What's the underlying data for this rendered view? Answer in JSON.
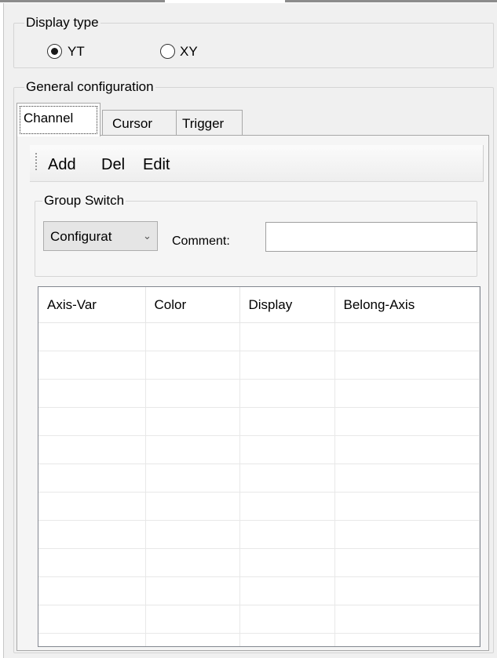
{
  "display_type": {
    "title": "Display type",
    "options": [
      {
        "label": "YT",
        "selected": true
      },
      {
        "label": "XY",
        "selected": false
      }
    ]
  },
  "general_configuration": {
    "title": "General configuration",
    "tabs": [
      {
        "label": "Channel",
        "active": true
      },
      {
        "label": "Cursor",
        "active": false
      },
      {
        "label": "Trigger",
        "active": false
      }
    ],
    "toolbar": {
      "add_label": "Add",
      "del_label": "Del",
      "edit_label": "Edit"
    },
    "group_switch": {
      "title": "Group Switch",
      "select_value": "Configurat",
      "comment_label": "Comment:",
      "comment_value": ""
    },
    "grid": {
      "columns": [
        "Axis-Var",
        "Color",
        "Display",
        "Belong-Axis"
      ],
      "rows": []
    }
  }
}
